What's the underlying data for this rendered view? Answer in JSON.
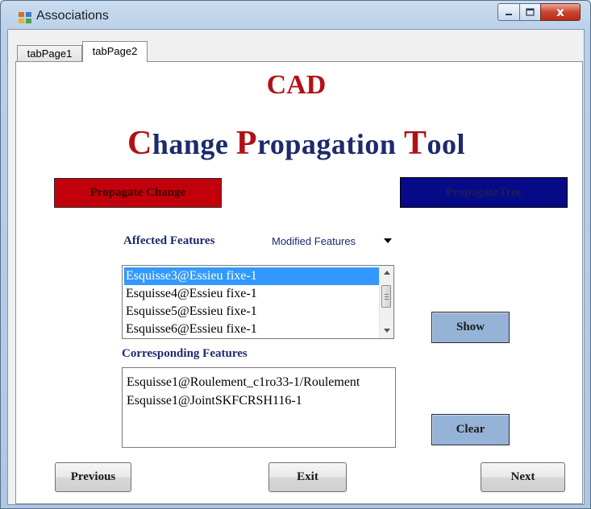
{
  "window": {
    "title": "Associations",
    "controls": {
      "minimize_icon": "minimize-icon",
      "maximize_icon": "maximize-icon",
      "close_label": "x"
    }
  },
  "tabs": [
    {
      "label": "tabPage1"
    },
    {
      "label": "tabPage2"
    }
  ],
  "heading": {
    "line1": "CAD",
    "line2": {
      "parts": [
        "C",
        "hange ",
        "P",
        "ropagation ",
        "T",
        "ool"
      ]
    }
  },
  "buttons": {
    "propagate_change": "Propagate Change",
    "propagate_tree": "PropagateTree",
    "show": "Show",
    "clear": "Clear",
    "previous": "Previous",
    "exit": "Exit",
    "next": "Next"
  },
  "affected": {
    "label": "Affected Features",
    "combo_value": "Modified Features",
    "items": [
      {
        "text": "Esquisse3@Essieu fixe-1",
        "selected": true
      },
      {
        "text": "Esquisse4@Essieu fixe-1",
        "selected": false
      },
      {
        "text": "Esquisse5@Essieu fixe-1",
        "selected": false
      },
      {
        "text": "Esquisse6@Essieu fixe-1",
        "selected": false
      }
    ]
  },
  "corresponding": {
    "label": "Corresponding Features",
    "lines": [
      "Esquisse1@Roulement_c1ro33-1/Roulement",
      "Esquisse1@JointSKFCRSH116-1"
    ]
  },
  "colors": {
    "accent_red": "#b11116",
    "accent_navy": "#1d2a6b",
    "button_red": "#c1000b",
    "button_navy": "#070a86",
    "side_button": "#95b3d7",
    "selection": "#3399ff"
  }
}
